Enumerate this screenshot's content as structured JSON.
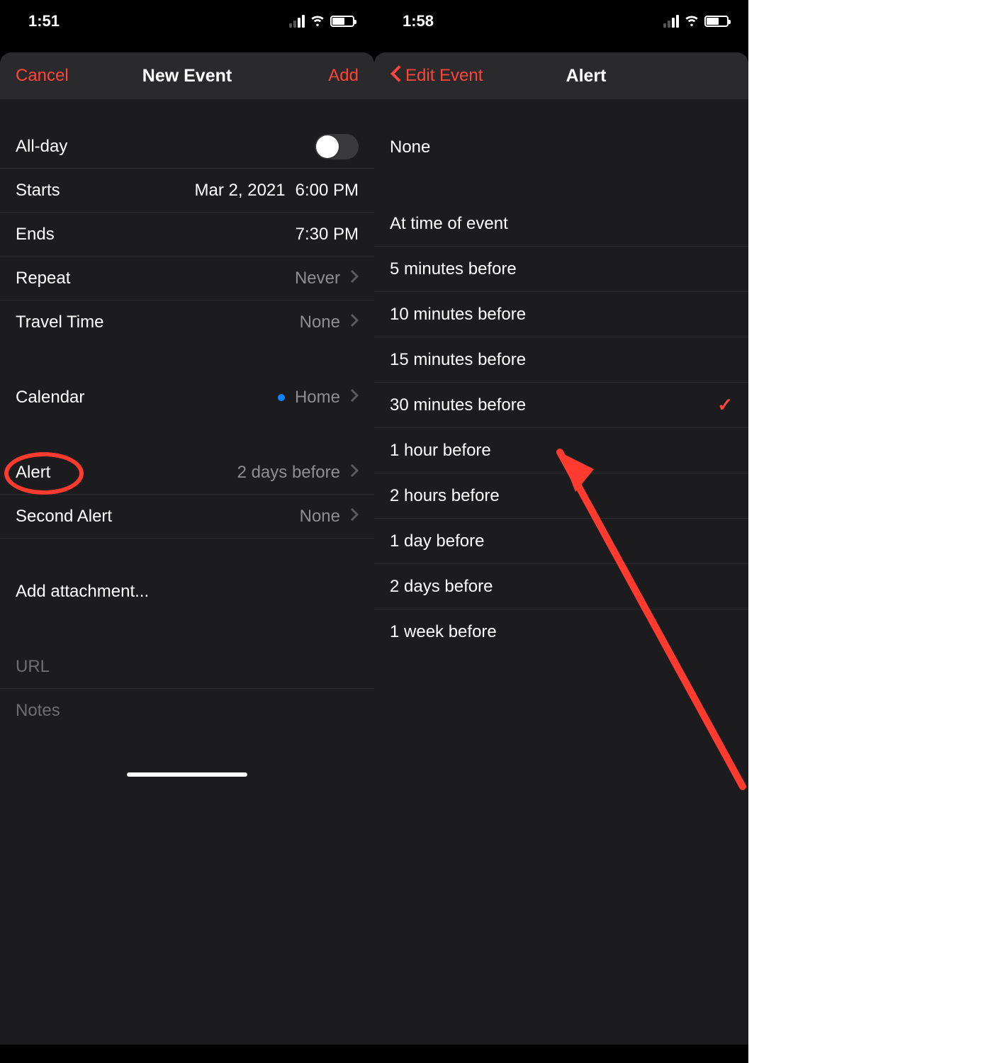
{
  "left": {
    "status_time": "1:51",
    "nav": {
      "cancel": "Cancel",
      "title": "New Event",
      "add": "Add"
    },
    "rows": {
      "allday_label": "All-day",
      "starts_label": "Starts",
      "starts_date": "Mar 2, 2021",
      "starts_time": "6:00 PM",
      "ends_label": "Ends",
      "ends_time": "7:30 PM",
      "repeat_label": "Repeat",
      "repeat_value": "Never",
      "travel_label": "Travel Time",
      "travel_value": "None",
      "calendar_label": "Calendar",
      "calendar_value": "Home",
      "alert_label": "Alert",
      "alert_value": "2 days before",
      "second_alert_label": "Second Alert",
      "second_alert_value": "None",
      "attachment_label": "Add attachment...",
      "url_placeholder": "URL",
      "notes_placeholder": "Notes"
    }
  },
  "right": {
    "status_time": "1:58",
    "nav": {
      "back": "Edit Event",
      "title": "Alert"
    },
    "none_label": "None",
    "options": [
      {
        "label": "At time of event",
        "checked": false
      },
      {
        "label": "5 minutes before",
        "checked": false
      },
      {
        "label": "10 minutes before",
        "checked": false
      },
      {
        "label": "15 minutes before",
        "checked": false
      },
      {
        "label": "30 minutes before",
        "checked": true
      },
      {
        "label": "1 hour before",
        "checked": false
      },
      {
        "label": "2 hours before",
        "checked": false
      },
      {
        "label": "1 day before",
        "checked": false
      },
      {
        "label": "2 days before",
        "checked": false
      },
      {
        "label": "1 week before",
        "checked": false
      }
    ]
  }
}
